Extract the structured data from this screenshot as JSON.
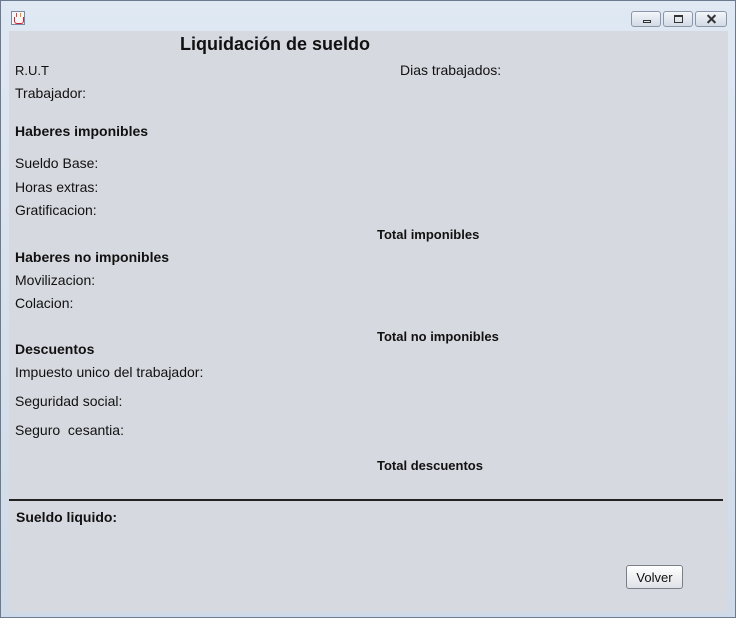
{
  "window": {
    "title": ""
  },
  "header": {
    "title": "Liquidación de sueldo"
  },
  "labels": {
    "rut": "R.U.T",
    "dias": "Dias trabajados:",
    "trabajador": "Trabajador:"
  },
  "imponibles": {
    "heading": "Haberes imponibles",
    "sueldo_base": "Sueldo Base:",
    "horas_extras": "Horas extras:",
    "gratificacion": "Gratificacion:",
    "total": "Total imponibles"
  },
  "no_imponibles": {
    "heading": "Haberes no imponibles",
    "movilizacion": "Movilizacion:",
    "colacion": "Colacion:",
    "total": "Total no imponibles"
  },
  "descuentos": {
    "heading": "Descuentos",
    "impuesto": "Impuesto unico del trabajador:",
    "seguridad": "Seguridad social:",
    "seguro": "Seguro  cesantia:",
    "total": "Total descuentos"
  },
  "liquido": {
    "label": "Sueldo liquido:"
  },
  "buttons": {
    "volver": "Volver"
  },
  "icons": {
    "app": "java-app-icon",
    "minimize": "minimize-icon",
    "maximize": "maximize-icon",
    "close": "close-icon"
  }
}
